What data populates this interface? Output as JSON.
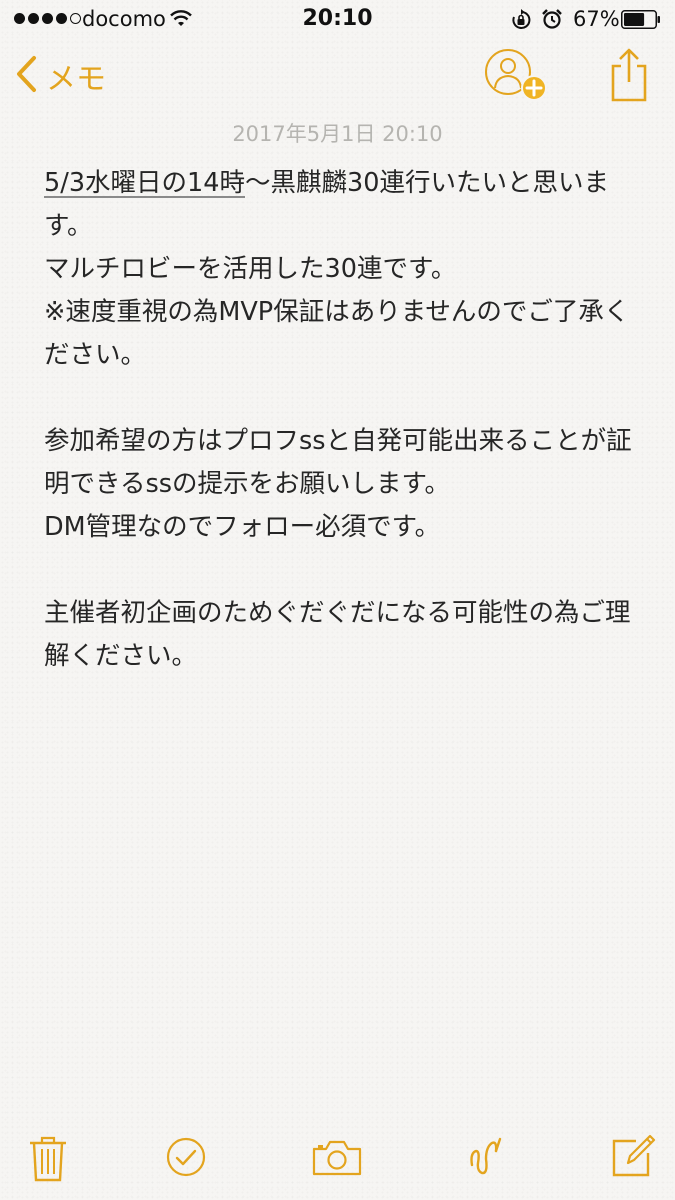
{
  "status_bar": {
    "carrier": "docomo",
    "time": "20:10",
    "battery_percent": "67%",
    "battery_level": 0.67
  },
  "nav": {
    "back_label": "メモ"
  },
  "note": {
    "date": "2017年5月1日 20:10",
    "linked_text": "5/3水曜日の14時",
    "body_rest": "〜黒麒麟30連行いたいと思います。\nマルチロビーを活用した30連です。\n※速度重視の為MVP保証はありませんのでご了承ください。\n\n参加希望の方はプロフssと自発可能出来ることが証明できるssの提示をお願いします。\nDM管理なのでフォロー必須です。\n\n主催者初企画のためぐだぐだになる可能性の為ご理解ください。"
  },
  "colors": {
    "accent": "#e3a41e",
    "text": "#262626",
    "date": "#b5b4b0"
  },
  "icons": {
    "toolbar": [
      "trash-icon",
      "checklist-icon",
      "camera-icon",
      "sketch-icon",
      "compose-icon"
    ]
  }
}
